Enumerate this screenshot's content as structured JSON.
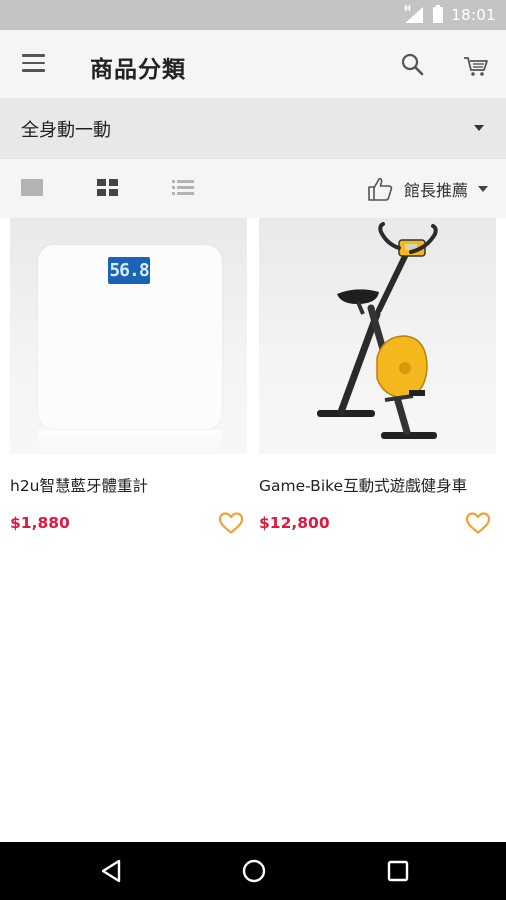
{
  "status_bar": {
    "time": "18:01",
    "signal_label": "H"
  },
  "app_bar": {
    "title": "商品分類"
  },
  "category": {
    "selected": "全身動一動"
  },
  "sort": {
    "selected": "館長推薦"
  },
  "products": [
    {
      "name": "h2u智慧藍牙體重計",
      "price": "$1,880",
      "display_value": "56.8"
    },
    {
      "name": "Game-Bike互動式遊戲健身車",
      "price": "$12,800"
    }
  ],
  "colors": {
    "price": "#e0173f",
    "favorite": "#f0a23a",
    "scale_display": "#1b63b5"
  }
}
